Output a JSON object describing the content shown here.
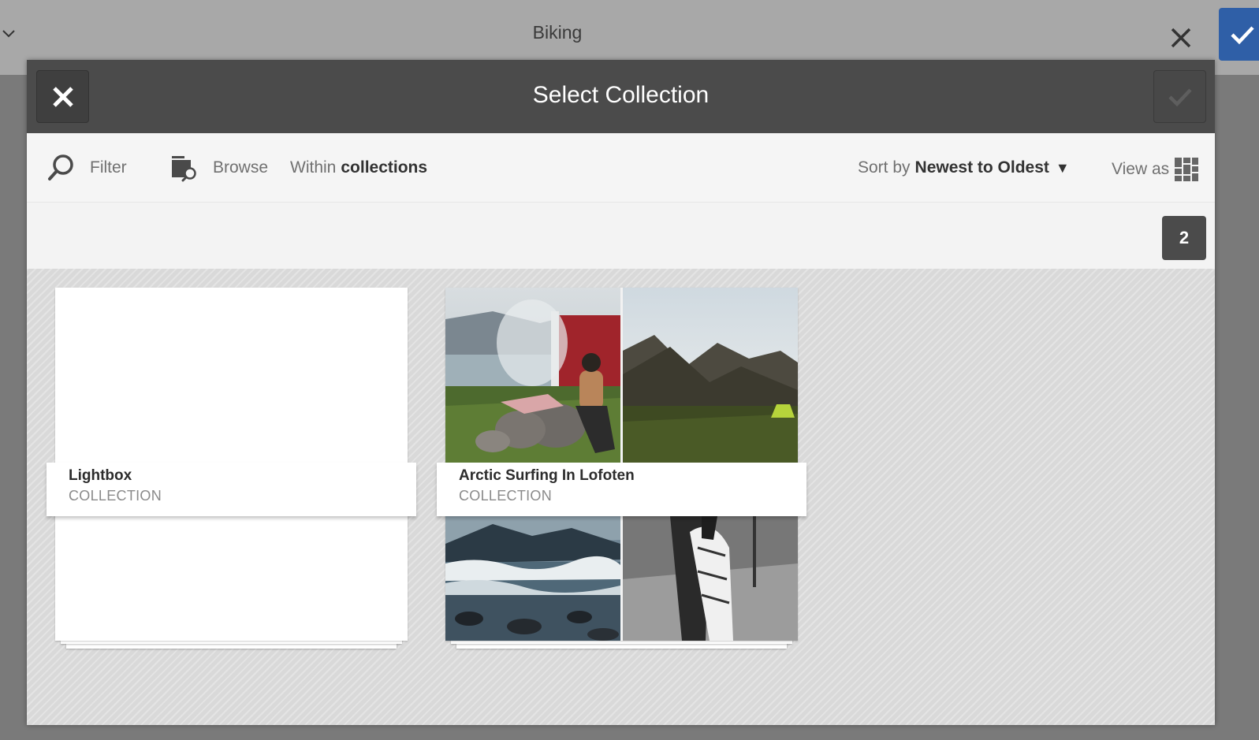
{
  "background": {
    "title": "Biking"
  },
  "dialog": {
    "title": "Select Collection"
  },
  "toolbar": {
    "filter_label": "Filter",
    "browse_label": "Browse",
    "within_prefix": "Within",
    "within_value": "collections",
    "sort_prefix": "Sort by",
    "sort_value": "Newest to Oldest",
    "view_label": "View as"
  },
  "count": "2",
  "collections": [
    {
      "name": "Lightbox",
      "type": "COLLECTION"
    },
    {
      "name": "Arctic Surfing In Lofoten",
      "type": "COLLECTION"
    }
  ],
  "colors": {
    "header": "#4b4b4b",
    "accent": "#2f5fa7",
    "grid": "#d9d9d9"
  }
}
